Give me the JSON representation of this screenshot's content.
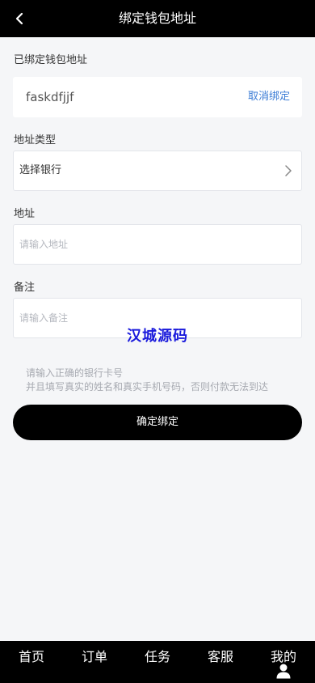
{
  "header": {
    "title": "绑定钱包地址"
  },
  "bound": {
    "label": "已绑定钱包地址",
    "value": "faskdfjjf",
    "unbind_label": "取消绑定"
  },
  "address_type": {
    "label": "地址类型",
    "value": "选择银行"
  },
  "address": {
    "label": "地址",
    "placeholder": "请输入地址"
  },
  "note": {
    "label": "备注",
    "placeholder": "请输入备注"
  },
  "watermark": "汉城源码",
  "hints": {
    "line1": "请输入正确的银行卡号",
    "line2": "并且填写真实的姓名和真实手机号码，否则付款无法到达"
  },
  "confirm_label": "确定绑定",
  "tabs": [
    {
      "label": "首页"
    },
    {
      "label": "订单"
    },
    {
      "label": "任务"
    },
    {
      "label": "客服"
    },
    {
      "label": "我的"
    }
  ],
  "colors": {
    "link": "#3a7bd5",
    "watermark": "#1a1adc",
    "background": "#f5f6f8"
  }
}
